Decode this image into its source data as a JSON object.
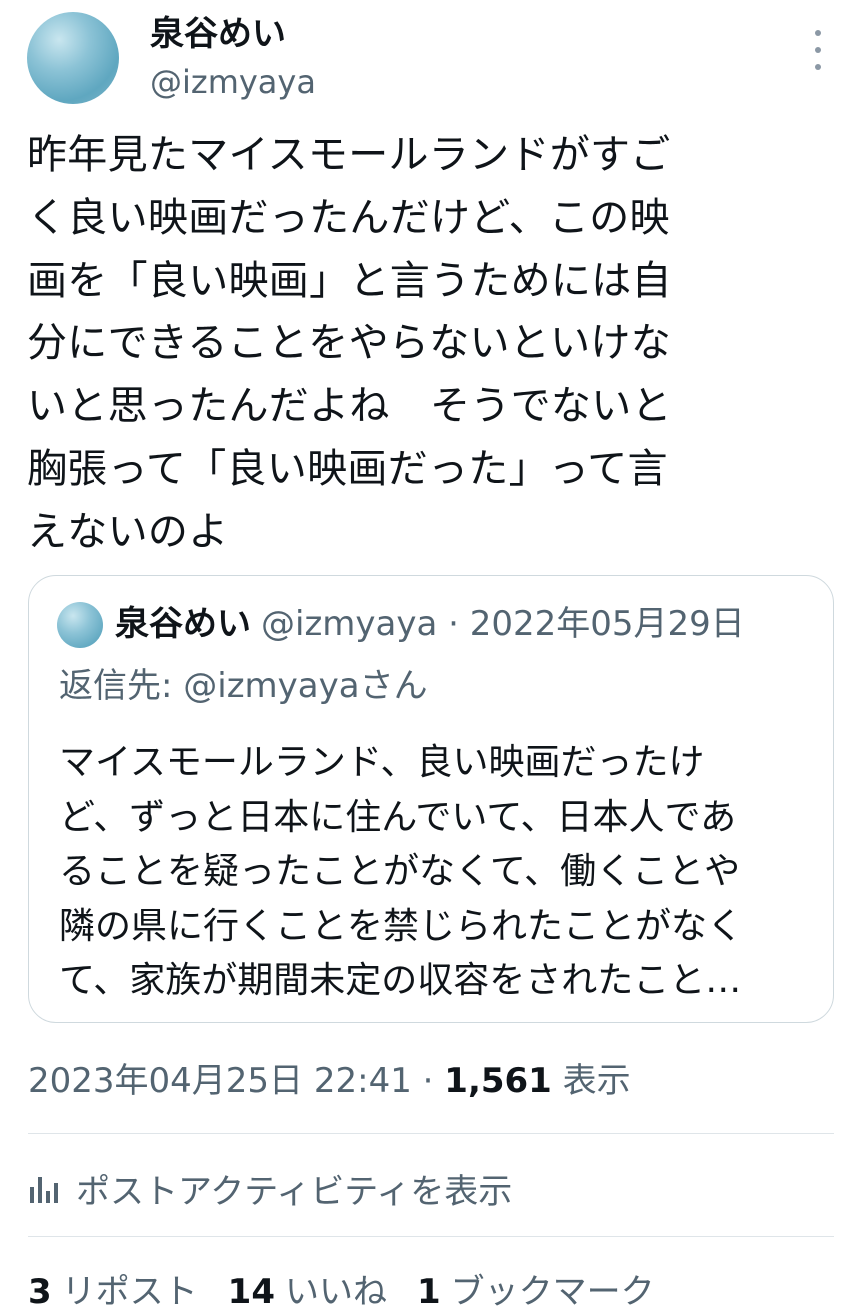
{
  "author": {
    "display_name": "泉谷めい",
    "handle": "@izmyaya"
  },
  "tweet": {
    "text": "昨年見たマイスモールランドがすご\nく良い映画だったんだけど、この映\n画を「良い映画」と言うためには自\n分にできることをやらないといけな\nいと思ったんだよね　そうでないと\n胸張って「良い映画だった」って言\nえないのよ"
  },
  "quote": {
    "display_name": "泉谷めい",
    "meta": "@izmyaya · 2022年05月29日",
    "reply_to": "返信先: @izmyayaさん",
    "text": "マイスモールランド、良い映画だったけ\nど、ずっと日本に住んでいて、日本人であ\nることを疑ったことがなくて、働くことや\n隣の県に行くことを禁じられたことがなく\nて、家族が期間未定の収容をされたこと…"
  },
  "meta": {
    "timestamp": "2023年04月25日 22:41 · ",
    "views_count": "1,561",
    "views_label": " 表示"
  },
  "activity": {
    "icon": "bar-chart-icon",
    "label": "ポストアクティビティを表示"
  },
  "stats": {
    "reposts_count": "3",
    "reposts_label": "リポスト",
    "likes_count": "14",
    "likes_label": "いいね",
    "bookmarks_count": "1",
    "bookmarks_label": "ブックマーク"
  },
  "colors": {
    "text": "#0f1419",
    "secondary": "#536471",
    "border": "#cfd9de"
  }
}
